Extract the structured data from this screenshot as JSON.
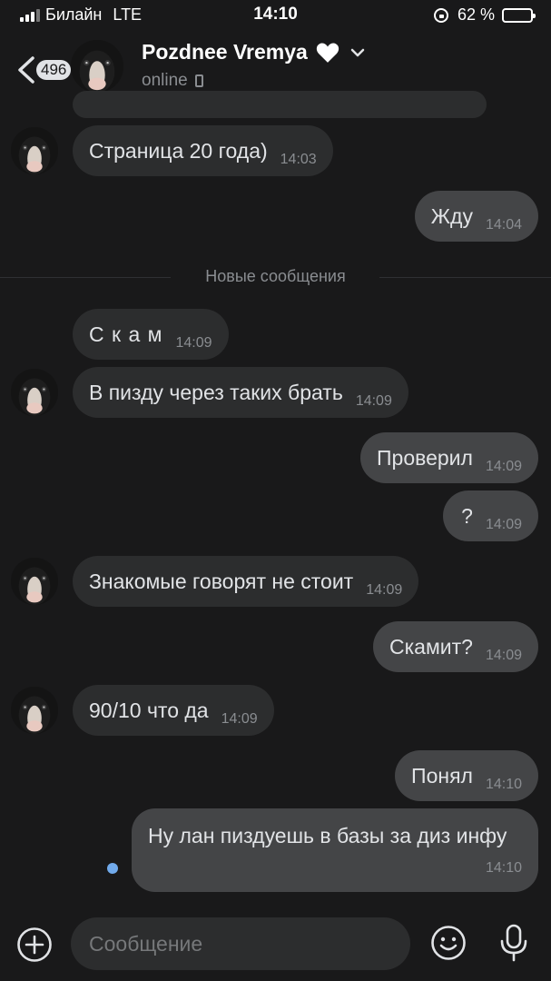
{
  "status_bar": {
    "carrier": "Билайн",
    "network": "LTE",
    "time": "14:10",
    "battery": "62 %",
    "battery_level": 0.62
  },
  "header": {
    "unread_count": "496",
    "contact_name": "Pozdnee Vremya",
    "status": "online",
    "icons": [
      "back-arrow-icon",
      "heart-icon",
      "chevron-down-icon",
      "phone-icon"
    ]
  },
  "messages": [
    {
      "text": "Страница 20 года)",
      "time": "14:03",
      "direction": "in"
    },
    {
      "text": "Жду",
      "time": "14:04",
      "direction": "out"
    },
    {
      "text": "С к а м",
      "time": "14:09",
      "direction": "in"
    },
    {
      "text": "В пизду через таких брать",
      "time": "14:09",
      "direction": "in"
    },
    {
      "text": "Проверил",
      "time": "14:09",
      "direction": "out"
    },
    {
      "text": "?",
      "time": "14:09",
      "direction": "out"
    },
    {
      "text": "Знакомые говорят не стоит",
      "time": "14:09",
      "direction": "in"
    },
    {
      "text": "Скамит?",
      "time": "14:09",
      "direction": "out"
    },
    {
      "text": "90/10 что да",
      "time": "14:09",
      "direction": "in"
    },
    {
      "text": "Понял",
      "time": "14:10",
      "direction": "out"
    },
    {
      "text": "Ну лан пиздуешь в базы за диз инфу",
      "time": "14:10",
      "direction": "out",
      "unread": true
    }
  ],
  "new_messages_divider": "Новые сообщения",
  "composer": {
    "placeholder": "Сообщение",
    "icons": [
      "plus-circle-icon",
      "smile-icon",
      "microphone-icon"
    ]
  },
  "colors": {
    "background": "#19191a",
    "incoming_bubble": "#2c2d2e",
    "outgoing_bubble": "#444547",
    "accent": "#71aaeb"
  }
}
